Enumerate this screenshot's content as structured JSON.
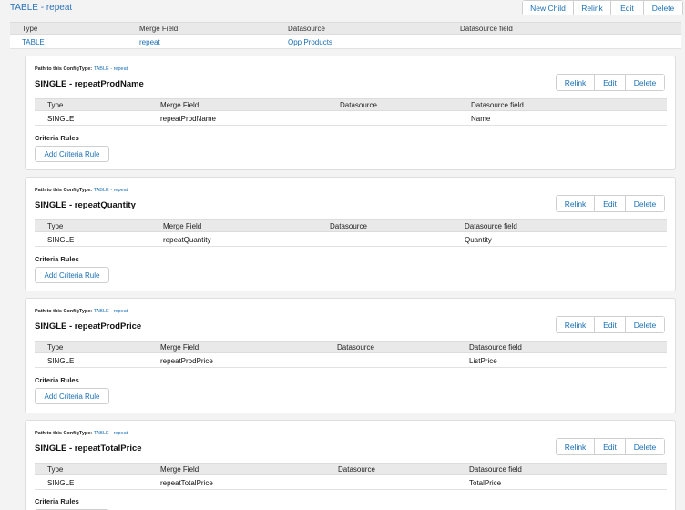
{
  "header": {
    "title": "TABLE - repeat",
    "buttons": {
      "new_child": "New Child",
      "relink": "Relink",
      "edit": "Edit",
      "delete": "Delete"
    }
  },
  "top_table": {
    "columns": [
      "Type",
      "Merge Field",
      "Datasource",
      "Datasource field"
    ],
    "row": [
      "TABLE",
      "repeat",
      "Opp Products",
      ""
    ]
  },
  "common": {
    "path_label": "Path to this ConfigType:",
    "path_link": "TABLE - repeat",
    "criteria_label": "Criteria Rules",
    "add_rule": "Add Criteria Rule",
    "relink": "Relink",
    "edit": "Edit",
    "delete": "Delete",
    "columns": [
      "Type",
      "Merge Field",
      "Datasource",
      "Datasource field"
    ]
  },
  "panels": [
    {
      "title": "SINGLE - repeatProdName",
      "row": [
        "SINGLE",
        "repeatProdName",
        "",
        "Name"
      ]
    },
    {
      "title": "SINGLE - repeatQuantity",
      "row": [
        "SINGLE",
        "repeatQuantity",
        "",
        "Quantity"
      ]
    },
    {
      "title": "SINGLE - repeatProdPrice",
      "row": [
        "SINGLE",
        "repeatProdPrice",
        "",
        "ListPrice"
      ]
    },
    {
      "title": "SINGLE - repeatTotalPrice",
      "row": [
        "SINGLE",
        "repeatTotalPrice",
        "",
        "TotalPrice"
      ]
    }
  ]
}
